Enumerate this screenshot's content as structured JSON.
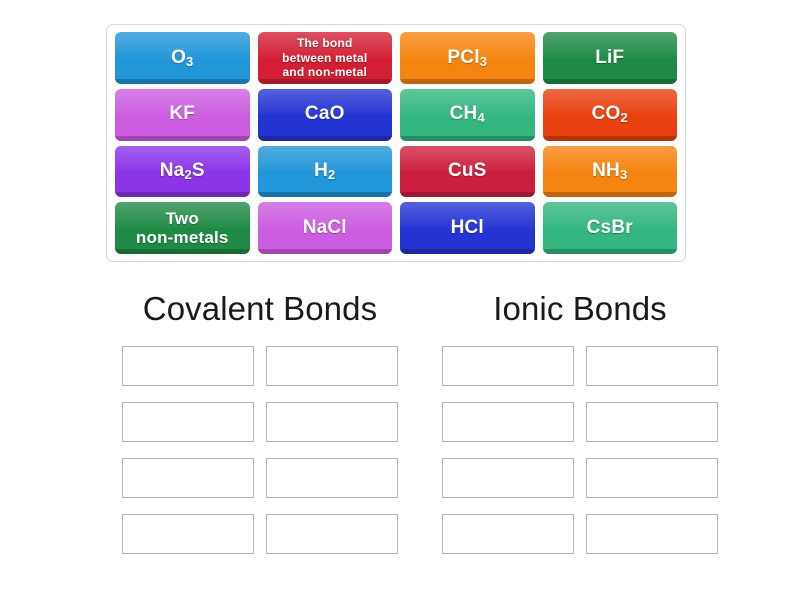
{
  "activity": {
    "type": "group-sort",
    "tray_tile_count": 16,
    "group_count": 2,
    "dropzones_per_group": 8
  },
  "tiles": [
    {
      "id": "tile-o3",
      "label": "O",
      "sub": "3",
      "html": "O<sub>3</sub>",
      "color": "#2196d8",
      "style": "normal"
    },
    {
      "id": "tile-bond-metal",
      "label": "The bond between metal and non-metal",
      "html": "The bond<br>between metal<br>and non-metal",
      "color": "#d21f35",
      "style": "small"
    },
    {
      "id": "tile-pcl3",
      "label": "PCl",
      "sub": "3",
      "html": "PCl<sub>3</sub>",
      "color": "#f58410",
      "style": "normal"
    },
    {
      "id": "tile-lif",
      "label": "LiF",
      "sub": "",
      "html": "LiF",
      "color": "#1f8a45",
      "style": "normal"
    },
    {
      "id": "tile-kf",
      "label": "KF",
      "sub": "",
      "html": "KF",
      "color": "#cc5ce0",
      "style": "normal"
    },
    {
      "id": "tile-cao",
      "label": "CaO",
      "sub": "",
      "html": "CaO",
      "color": "#2434d3",
      "style": "normal"
    },
    {
      "id": "tile-ch4",
      "label": "CH",
      "sub": "4",
      "html": "CH<sub>4</sub>",
      "color": "#33b67f",
      "style": "normal"
    },
    {
      "id": "tile-co2",
      "label": "CO",
      "sub": "2",
      "html": "CO<sub>2</sub>",
      "color": "#e8400f",
      "style": "normal"
    },
    {
      "id": "tile-na2s",
      "label": "Na",
      "sub": "2S",
      "html": "Na<sub>2</sub>S",
      "color": "#8b34e8",
      "style": "normal"
    },
    {
      "id": "tile-h2",
      "label": "H",
      "sub": "2",
      "html": "H<sub>2</sub>",
      "color": "#2196d8",
      "style": "normal"
    },
    {
      "id": "tile-cus",
      "label": "CuS",
      "sub": "",
      "html": "CuS",
      "color": "#cc1f3d",
      "style": "normal"
    },
    {
      "id": "tile-nh3",
      "label": "NH",
      "sub": "3",
      "html": "NH<sub>3</sub>",
      "color": "#f58410",
      "style": "normal"
    },
    {
      "id": "tile-two-nonmetals",
      "label": "Two non-metals",
      "sub": "",
      "html": "Two<br>non-metals",
      "color": "#1f8a45",
      "style": "two-line"
    },
    {
      "id": "tile-nacl",
      "label": "NaCl",
      "sub": "",
      "html": "NaCl",
      "color": "#cc5ce0",
      "style": "normal"
    },
    {
      "id": "tile-hcl",
      "label": "HCl",
      "sub": "",
      "html": "HCl",
      "color": "#2434d3",
      "style": "normal"
    },
    {
      "id": "tile-csbr",
      "label": "CsBr",
      "sub": "",
      "html": "CsBr",
      "color": "#33b67f",
      "style": "normal"
    }
  ],
  "groups": [
    {
      "id": "group-covalent",
      "title": "Covalent Bonds",
      "dropzones": [
        {
          "id": "covalent-slot-1",
          "value": ""
        },
        {
          "id": "covalent-slot-2",
          "value": ""
        },
        {
          "id": "covalent-slot-3",
          "value": ""
        },
        {
          "id": "covalent-slot-4",
          "value": ""
        },
        {
          "id": "covalent-slot-5",
          "value": ""
        },
        {
          "id": "covalent-slot-6",
          "value": ""
        },
        {
          "id": "covalent-slot-7",
          "value": ""
        },
        {
          "id": "covalent-slot-8",
          "value": ""
        }
      ]
    },
    {
      "id": "group-ionic",
      "title": "Ionic Bonds",
      "dropzones": [
        {
          "id": "ionic-slot-1",
          "value": ""
        },
        {
          "id": "ionic-slot-2",
          "value": ""
        },
        {
          "id": "ionic-slot-3",
          "value": ""
        },
        {
          "id": "ionic-slot-4",
          "value": ""
        },
        {
          "id": "ionic-slot-5",
          "value": ""
        },
        {
          "id": "ionic-slot-6",
          "value": ""
        },
        {
          "id": "ionic-slot-7",
          "value": ""
        },
        {
          "id": "ionic-slot-8",
          "value": ""
        }
      ]
    }
  ],
  "colors": {
    "page_background": "#ffffff",
    "tray_border": "#d8d8d8",
    "dropzone_border": "#b3b3b3",
    "title_text": "#1a1a1a",
    "tile_text": "#ffffff"
  }
}
